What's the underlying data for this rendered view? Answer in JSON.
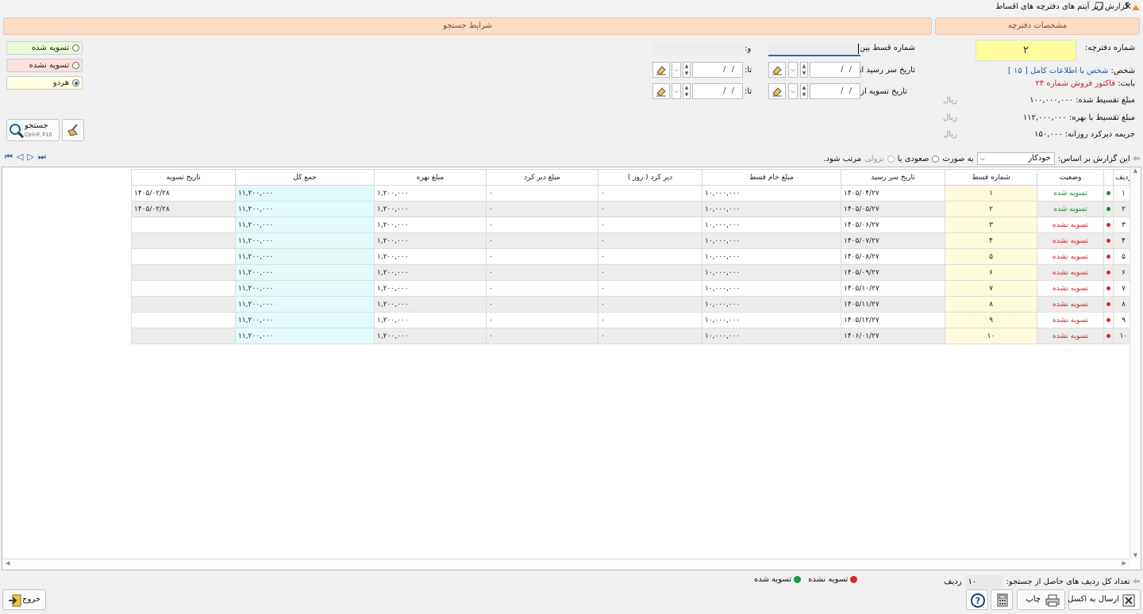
{
  "window": {
    "title": "گزارش ریز آیتم های دفترچه های اقساط",
    "maximize_icon": "restore-icon",
    "close_glyph": "✕"
  },
  "headers": {
    "booklet_info": "مشخصات دفترچه",
    "search_conditions": "شرایط جستجو"
  },
  "booklet": {
    "number_label": "شماره دفترچه:",
    "number_value": "۲",
    "person_label": "شخص:",
    "person_value": "شخص با اطلاعات کامل [ ۱۵ ]",
    "for_label": "بابت:",
    "for_value": "فاکتور فروش شماره ۲۴",
    "amount_label": "مبلغ تقسیط شده:",
    "amount_value": "۱۰۰,۰۰۰,۰۰۰",
    "amount_interest_label": "مبلغ تقسیط با بهره:",
    "amount_interest_value": "۱۱۲,۰۰۰,۰۰۰",
    "penalty_label": "جریمه دیرکرد روزانه:",
    "penalty_value": "۱۵۰,۰۰۰",
    "currency": "ریال"
  },
  "search": {
    "installment_between_label": "شماره قسط بین:",
    "and_label": "و:",
    "due_from_label": "تاریخ سر رسید از:",
    "settle_from_label": "تاریخ تسویه از:",
    "to_label": "تا:",
    "date_placeholder": "/ /",
    "options": [
      "تسویه شده",
      "تسویه نشده",
      "هردو"
    ],
    "selected_option": "هردو",
    "search_button": "جستجو",
    "search_shortcut": "Ctrl+F, F10"
  },
  "sort": {
    "label": "این گزارش بر اساس:",
    "value": "خودکار",
    "as_label": "به صورت",
    "asc": "صعودی یا",
    "desc": "نزولی",
    "suffix": "مرتب شود."
  },
  "table": {
    "columns": [
      "ردیف",
      "",
      "وضعیت",
      "شماره قسط",
      "تاریخ سر رسید",
      "مبلغ خام قسط",
      "دیر کرد ( روز )",
      "مبلغ دیر کرد",
      "مبلغ بهره",
      "جمع کل",
      "تاریخ تسویه"
    ],
    "rows": [
      {
        "row": "۱",
        "status": "تسویه شده",
        "settled": true,
        "num": "۱",
        "due": "۱۴۰۵/۰۴/۲۷",
        "raw": "۱۰,۰۰۰,۰۰۰",
        "days": "۰",
        "late": "۰",
        "interest": "۱,۲۰۰,۰۰۰",
        "total": "۱۱,۲۰۰,۰۰۰",
        "settle_date": "۱۴۰۵/۰۲/۲۸"
      },
      {
        "row": "۲",
        "status": "تسویه شده",
        "settled": true,
        "num": "۲",
        "due": "۱۴۰۵/۰۵/۲۷",
        "raw": "۱۰,۰۰۰,۰۰۰",
        "days": "۰",
        "late": "۰",
        "interest": "۱,۲۰۰,۰۰۰",
        "total": "۱۱,۲۰۰,۰۰۰",
        "settle_date": "۱۴۰۵/۰۲/۲۸"
      },
      {
        "row": "۳",
        "status": "تسویه نشده",
        "settled": false,
        "num": "۳",
        "due": "۱۴۰۵/۰۶/۲۷",
        "raw": "۱۰,۰۰۰,۰۰۰",
        "days": "۰",
        "late": "۰",
        "interest": "۱,۲۰۰,۰۰۰",
        "total": "۱۱,۲۰۰,۰۰۰",
        "settle_date": ""
      },
      {
        "row": "۴",
        "status": "تسویه نشده",
        "settled": false,
        "num": "۴",
        "due": "۱۴۰۵/۰۷/۲۷",
        "raw": "۱۰,۰۰۰,۰۰۰",
        "days": "۰",
        "late": "۰",
        "interest": "۱,۲۰۰,۰۰۰",
        "total": "۱۱,۲۰۰,۰۰۰",
        "settle_date": ""
      },
      {
        "row": "۵",
        "status": "تسویه نشده",
        "settled": false,
        "num": "۵",
        "due": "۱۴۰۵/۰۸/۲۷",
        "raw": "۱۰,۰۰۰,۰۰۰",
        "days": "۰",
        "late": "۰",
        "interest": "۱,۲۰۰,۰۰۰",
        "total": "۱۱,۲۰۰,۰۰۰",
        "settle_date": ""
      },
      {
        "row": "۶",
        "status": "تسویه نشده",
        "settled": false,
        "num": "۶",
        "due": "۱۴۰۵/۰۹/۲۷",
        "raw": "۱۰,۰۰۰,۰۰۰",
        "days": "۰",
        "late": "۰",
        "interest": "۱,۲۰۰,۰۰۰",
        "total": "۱۱,۲۰۰,۰۰۰",
        "settle_date": ""
      },
      {
        "row": "۷",
        "status": "تسویه نشده",
        "settled": false,
        "num": "۷",
        "due": "۱۴۰۵/۱۰/۲۷",
        "raw": "۱۰,۰۰۰,۰۰۰",
        "days": "۰",
        "late": "۰",
        "interest": "۱,۲۰۰,۰۰۰",
        "total": "۱۱,۲۰۰,۰۰۰",
        "settle_date": ""
      },
      {
        "row": "۸",
        "status": "تسویه نشده",
        "settled": false,
        "num": "۸",
        "due": "۱۴۰۵/۱۱/۲۷",
        "raw": "۱۰,۰۰۰,۰۰۰",
        "days": "۰",
        "late": "۰",
        "interest": "۱,۲۰۰,۰۰۰",
        "total": "۱۱,۲۰۰,۰۰۰",
        "settle_date": ""
      },
      {
        "row": "۹",
        "status": "تسویه نشده",
        "settled": false,
        "num": "۹",
        "due": "۱۴۰۵/۱۲/۲۷",
        "raw": "۱۰,۰۰۰,۰۰۰",
        "days": "۰",
        "late": "۰",
        "interest": "۱,۲۰۰,۰۰۰",
        "total": "۱۱,۲۰۰,۰۰۰",
        "settle_date": ""
      },
      {
        "row": "۱۰",
        "status": "تسویه نشده",
        "settled": false,
        "num": "۱۰",
        "due": "۱۴۰۶/۰۱/۲۷",
        "raw": "۱۰,۰۰۰,۰۰۰",
        "days": "۰",
        "late": "۰",
        "interest": "۱,۲۰۰,۰۰۰",
        "total": "۱۱,۲۰۰,۰۰۰",
        "settle_date": ""
      }
    ]
  },
  "footer": {
    "count_label": "تعداد کل ردیف های حاصل از جستجو:",
    "count_value": "۱۰",
    "count_unit": "ردیف",
    "legend_settled": "تسویه شده",
    "legend_unsettled": "تسویه نشده",
    "excel_button": "ارسال به اکسل",
    "print_button": "چاپ",
    "exit_button": "خروج"
  },
  "colors": {
    "settled": "#1a8a2a",
    "unsettled": "#d52828",
    "header_bg": "#fbdcc4",
    "booklet_number_bg": "#fdfc9a"
  }
}
